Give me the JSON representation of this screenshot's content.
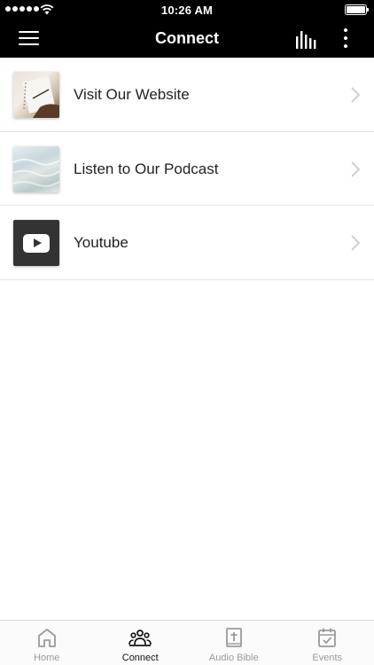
{
  "status_bar": {
    "time": "10:26 AM",
    "signal_bars": 5,
    "battery_level": 1.0
  },
  "nav_bar": {
    "title": "Connect",
    "left_icon": "hamburger-menu-icon",
    "right_icons": [
      "audio-bars-icon",
      "more-vertical-icon"
    ]
  },
  "list": {
    "items": [
      {
        "label": "Visit Our Website",
        "thumbnail": "notebook-photo"
      },
      {
        "label": "Listen to Our Podcast",
        "thumbnail": "water-photo"
      },
      {
        "label": "Youtube",
        "thumbnail": "youtube-logo"
      }
    ]
  },
  "tab_bar": {
    "tabs": [
      {
        "label": "Home",
        "icon": "home-icon",
        "active": false
      },
      {
        "label": "Connect",
        "icon": "people-icon",
        "active": true
      },
      {
        "label": "Audio Bible",
        "icon": "bible-icon",
        "active": false
      },
      {
        "label": "Events",
        "icon": "calendar-check-icon",
        "active": false
      }
    ]
  },
  "colors": {
    "header_bg": "#000000",
    "header_text": "#ffffff",
    "active_tab": "#111111",
    "inactive_tab": "#9a9a9a",
    "divider": "#e5e5e5"
  }
}
